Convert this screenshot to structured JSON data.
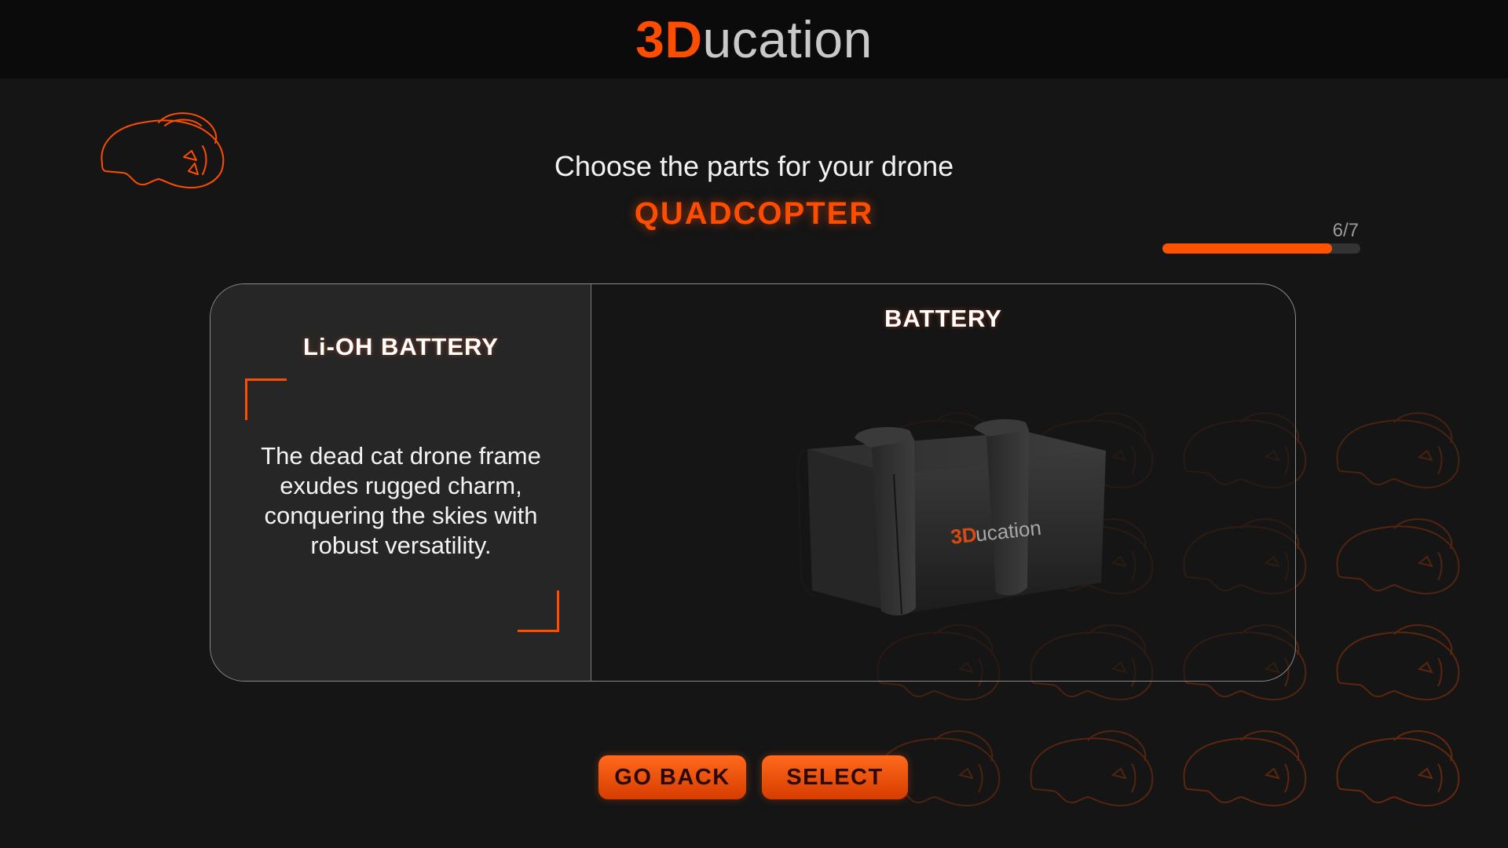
{
  "app": {
    "logo_accent": "3D",
    "logo_rest": "ucation"
  },
  "header": {
    "subtitle": "Choose the parts for your drone",
    "drone_type": "QUADCOPTER"
  },
  "progress": {
    "label": "6/7",
    "current": 6,
    "total": 7,
    "fill_fraction": 0.857
  },
  "part": {
    "name": "Li-OH BATTERY",
    "description": "The dead cat drone frame exudes rugged charm, conquering the skies with robust versatility.",
    "category": "BATTERY",
    "model_label_accent": "3D",
    "model_label_rest": "ucation"
  },
  "buttons": {
    "back_label": "GO BACK",
    "select_label": "SELECT"
  },
  "colors": {
    "accent": "#ff4d00",
    "background": "#151515",
    "topbar": "#0b0b0b",
    "panel": "#262626"
  },
  "icons": {
    "header_icon": "vr-headset-icon",
    "background_icon": "vr-headset-icon"
  }
}
